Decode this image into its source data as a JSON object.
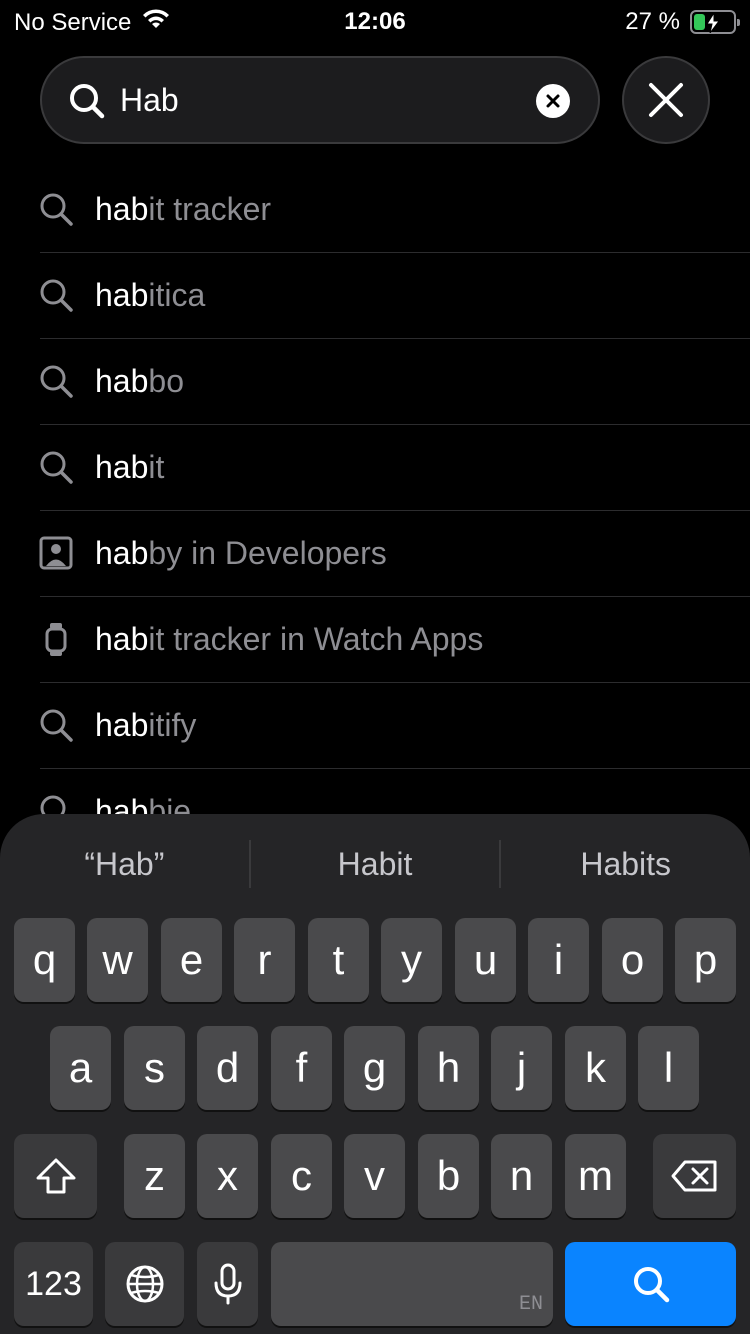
{
  "status_bar": {
    "carrier": "No Service",
    "time": "12:06",
    "battery_percent": "27 %",
    "battery_level": 0.27
  },
  "search": {
    "value": "Hab"
  },
  "suggestions": [
    {
      "highlight": "hab",
      "rest": "it tracker",
      "icon": "search-icon"
    },
    {
      "highlight": "hab",
      "rest": "itica",
      "icon": "search-icon"
    },
    {
      "highlight": "hab",
      "rest": "bo",
      "icon": "search-icon"
    },
    {
      "highlight": "hab",
      "rest": "it",
      "icon": "search-icon"
    },
    {
      "highlight": "hab",
      "rest": "by in Developers",
      "icon": "developer-icon"
    },
    {
      "highlight": "hab",
      "rest": "it tracker in Watch Apps",
      "icon": "watch-icon"
    },
    {
      "highlight": "hab",
      "rest": "itify",
      "icon": "search-icon"
    },
    {
      "highlight": "hab",
      "rest": "bie",
      "icon": "search-icon"
    }
  ],
  "keyboard": {
    "predictions": [
      "“Hab”",
      "Habit",
      "Habits"
    ],
    "row1": [
      "q",
      "w",
      "e",
      "r",
      "t",
      "y",
      "u",
      "i",
      "o",
      "p"
    ],
    "row2": [
      "a",
      "s",
      "d",
      "f",
      "g",
      "h",
      "j",
      "k",
      "l"
    ],
    "row3": [
      "z",
      "x",
      "c",
      "v",
      "b",
      "n",
      "m"
    ],
    "numbers_label": "123",
    "language_label": "EN",
    "shift_icon": "shift-icon",
    "backspace_icon": "backspace-icon",
    "globe_icon": "globe-icon",
    "mic_icon": "microphone-icon",
    "search_key_icon": "search-icon",
    "accent_color": "#0a84ff"
  }
}
